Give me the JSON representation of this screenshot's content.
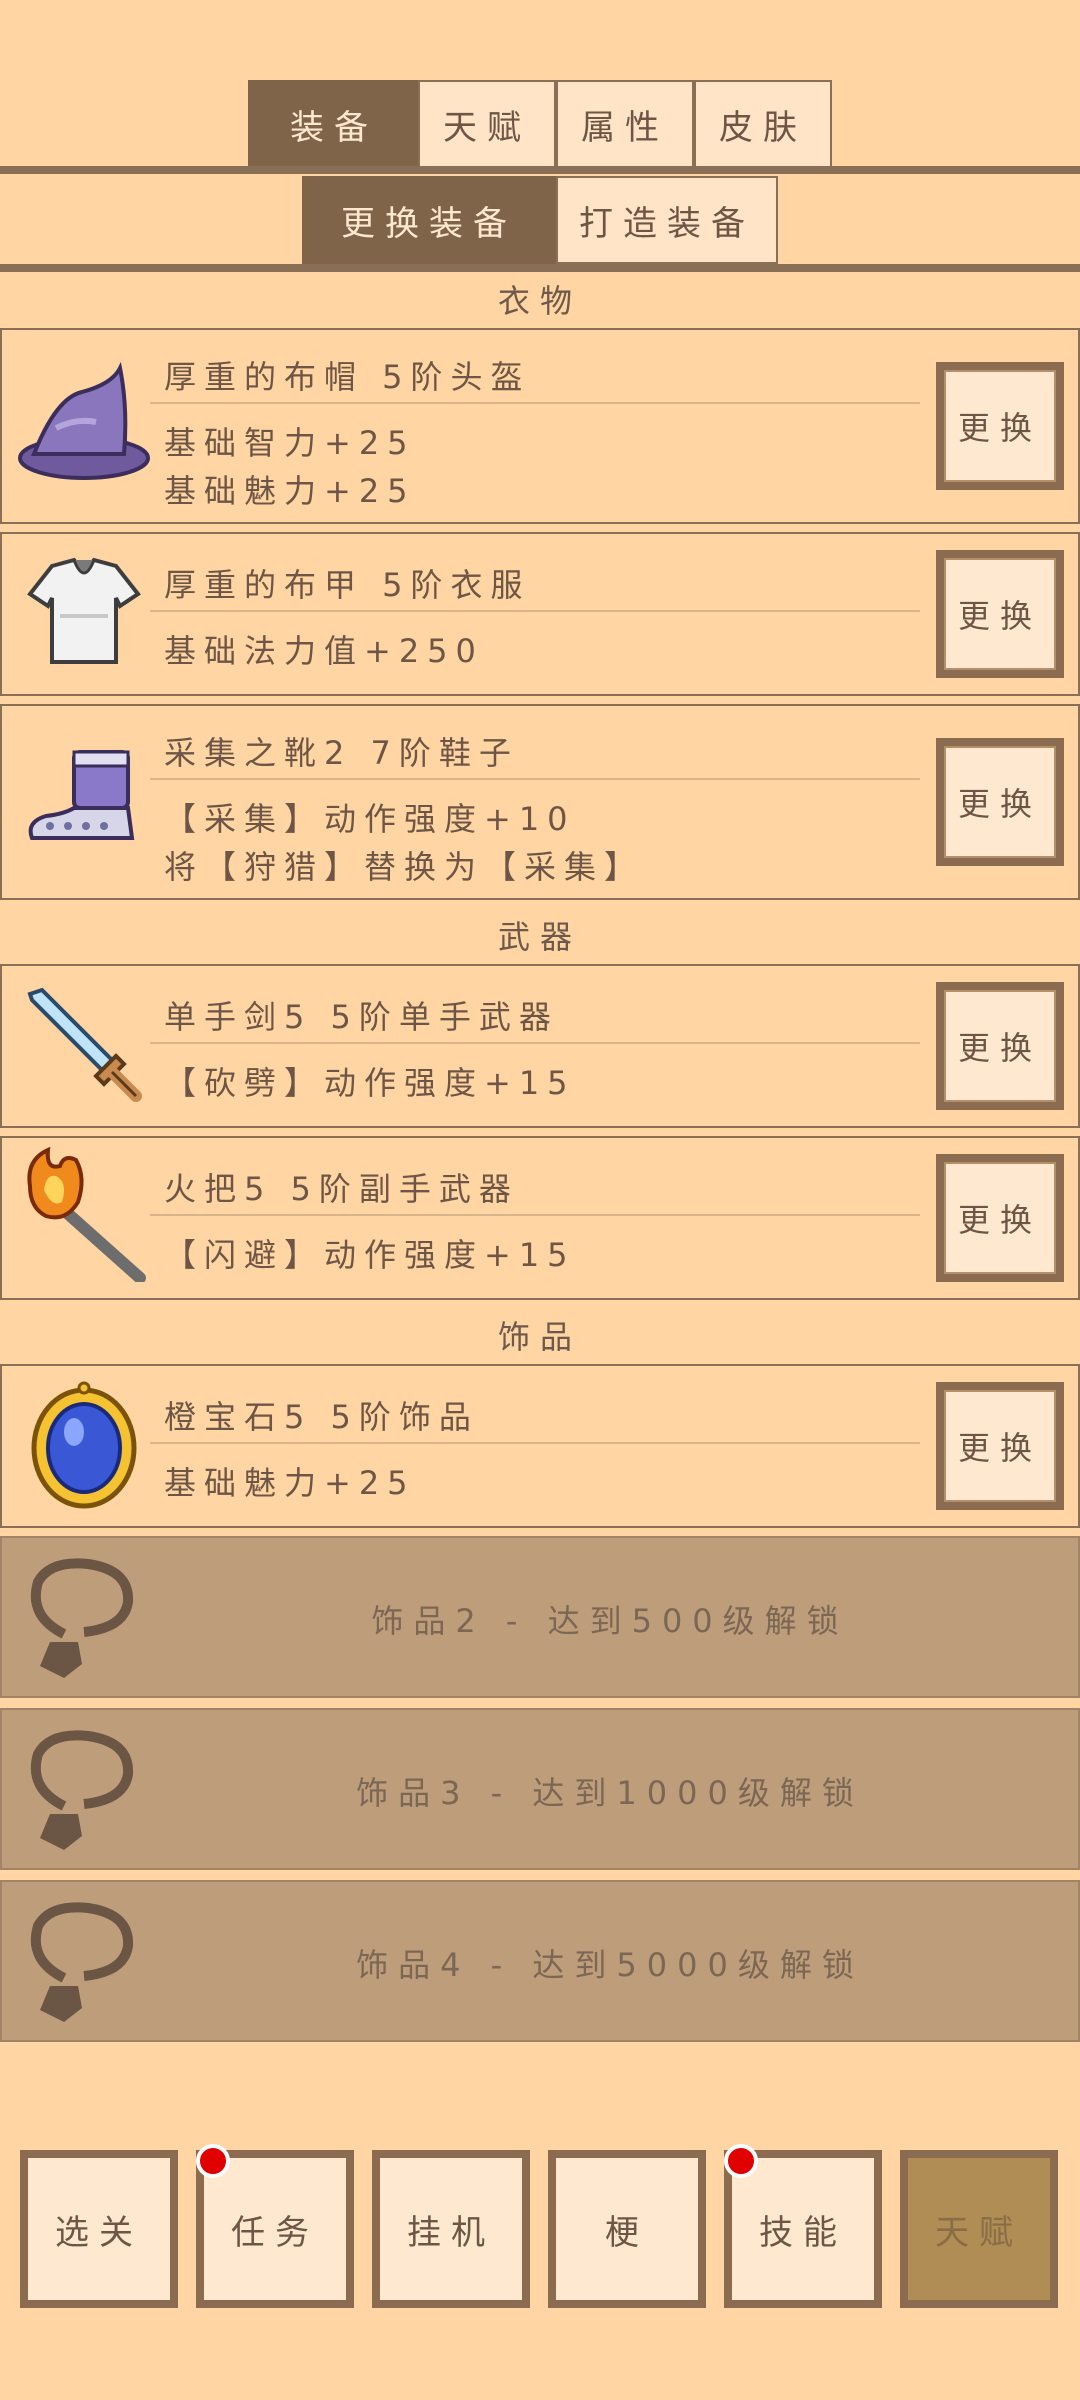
{
  "top_tabs": [
    {
      "label": "装备",
      "active": true
    },
    {
      "label": "天赋"
    },
    {
      "label": "属性"
    },
    {
      "label": "皮肤"
    }
  ],
  "sub_tabs": [
    {
      "label": "更换装备",
      "active": true
    },
    {
      "label": "打造装备"
    }
  ],
  "sections": {
    "clothing": "衣物",
    "weapons": "武器",
    "accessories": "饰品"
  },
  "items": [
    {
      "icon": "wizard-hat-icon",
      "name": "厚重的布帽  5阶头盔",
      "lines": [
        "基础智力+25",
        "基础魅力+25"
      ],
      "button": "更换"
    },
    {
      "icon": "cloth-armor-icon",
      "name": "厚重的布甲  5阶衣服",
      "lines": [
        "基础法力值+250"
      ],
      "button": "更换"
    },
    {
      "icon": "boots-icon",
      "name": "采集之靴2  7阶鞋子",
      "lines": [
        "【采集】动作强度+10",
        "将【狩猎】替换为【采集】"
      ],
      "button": "更换"
    },
    {
      "icon": "sword-icon",
      "name": "单手剑5  5阶单手武器",
      "lines": [
        "【砍劈】动作强度+15"
      ],
      "button": "更换"
    },
    {
      "icon": "torch-icon",
      "name": "火把5  5阶副手武器",
      "lines": [
        "【闪避】动作强度+15"
      ],
      "button": "更换"
    },
    {
      "icon": "gem-amulet-icon",
      "name": "橙宝石5  5阶饰品",
      "lines": [
        "基础魅力+25"
      ],
      "button": "更换"
    }
  ],
  "locked_slots": [
    {
      "icon": "necklace-icon",
      "text": "饰品2 - 达到500级解锁"
    },
    {
      "icon": "necklace-icon",
      "text": "饰品3 - 达到1000级解锁"
    },
    {
      "icon": "necklace-icon",
      "text": "饰品4 - 达到5000级解锁"
    }
  ],
  "bottom_nav": [
    {
      "label": "选关",
      "badge": false
    },
    {
      "label": "任务",
      "badge": true
    },
    {
      "label": "挂机",
      "badge": false
    },
    {
      "label": "梗",
      "badge": false
    },
    {
      "label": "技能",
      "badge": true
    },
    {
      "label": "天赋",
      "badge": false,
      "active": true
    }
  ],
  "colors": {
    "background": "#FFD5A3",
    "active_tab": "#7f6449",
    "border": "#8a6f57",
    "locked_row": "#BE9E7A",
    "badge": "#e00000",
    "active_nav": "#B08D55"
  }
}
